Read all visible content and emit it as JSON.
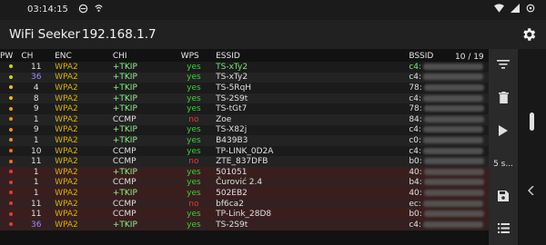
{
  "status_bar": {
    "time": "03:14:15"
  },
  "app": {
    "title": "WiFi Seeker",
    "ip": "192.168.1.7"
  },
  "table": {
    "headers": {
      "pw": "PW",
      "ch": "CH",
      "enc": "ENC",
      "chi": "CHI",
      "wps": "WPS",
      "essid": "ESSID",
      "bssid": "BSSID"
    },
    "counter": "10 / 19",
    "rows": [
      {
        "dot": "#c6d61a",
        "ch": "11",
        "ch_color": "#e0e0e0",
        "enc": "WPA2",
        "enc_color": "#d9b200",
        "chi": "+TKIP",
        "chi_color": "#8ef28e",
        "wps": "yes",
        "wps_color": "#3ccf3c",
        "essid": "TS-xTy2",
        "essid_color": "#7fe37f",
        "bssid": "c4:",
        "bssid_color": "#7fe37f",
        "bg": "dim"
      },
      {
        "dot": "#c6d61a",
        "ch": "36",
        "ch_color": "#9a8cff",
        "enc": "WPA2",
        "enc_color": "#d9b200",
        "chi": "+TKIP",
        "chi_color": "#8ef28e",
        "wps": "yes",
        "wps_color": "#3ccf3c",
        "essid": "TS-xTy2",
        "essid_color": "#e0e0e0",
        "bssid": "c4:",
        "bssid_color": "#e0e0e0",
        "bg": "alt"
      },
      {
        "dot": "#e8c01a",
        "ch": "4",
        "ch_color": "#e0e0e0",
        "enc": "WPA2",
        "enc_color": "#d9b200",
        "chi": "+TKIP",
        "chi_color": "#8ef28e",
        "wps": "yes",
        "wps_color": "#3ccf3c",
        "essid": "TS-5RqH",
        "essid_color": "#e0e0e0",
        "bssid": "78:",
        "bssid_color": "#e0e0e0",
        "bg": "dim"
      },
      {
        "dot": "#e8c01a",
        "ch": "8",
        "ch_color": "#e0e0e0",
        "enc": "WPA2",
        "enc_color": "#d9b200",
        "chi": "+TKIP",
        "chi_color": "#8ef28e",
        "wps": "yes",
        "wps_color": "#3ccf3c",
        "essid": "TS-2S9t",
        "essid_color": "#e0e0e0",
        "bssid": "c4:",
        "bssid_color": "#e0e0e0",
        "bg": "alt"
      },
      {
        "dot": "#e8a01a",
        "ch": "9",
        "ch_color": "#e0e0e0",
        "enc": "WPA2",
        "enc_color": "#d9b200",
        "chi": "+TKIP",
        "chi_color": "#8ef28e",
        "wps": "yes",
        "wps_color": "#3ccf3c",
        "essid": "TS-tGt7",
        "essid_color": "#e0e0e0",
        "bssid": "78:",
        "bssid_color": "#e0e0e0",
        "bg": "dim"
      },
      {
        "dot": "#e8901a",
        "ch": "1",
        "ch_color": "#e0e0e0",
        "enc": "WPA2",
        "enc_color": "#d9b200",
        "chi": "CCMP",
        "chi_color": "#e0e0e0",
        "wps": "no",
        "wps_color": "#e53935",
        "essid": "Zoe",
        "essid_color": "#e0e0e0",
        "bssid": "84:",
        "bssid_color": "#e0e0e0",
        "bg": "alt"
      },
      {
        "dot": "#e8901a",
        "ch": "9",
        "ch_color": "#e0e0e0",
        "enc": "WPA2",
        "enc_color": "#d9b200",
        "chi": "+TKIP",
        "chi_color": "#8ef28e",
        "wps": "yes",
        "wps_color": "#3ccf3c",
        "essid": "TS-X82j",
        "essid_color": "#e0e0e0",
        "bssid": "c4:",
        "bssid_color": "#e0e0e0",
        "bg": "dim"
      },
      {
        "dot": "#e8901a",
        "ch": "1",
        "ch_color": "#e0e0e0",
        "enc": "WPA2",
        "enc_color": "#d9b200",
        "chi": "+TKIP",
        "chi_color": "#8ef28e",
        "wps": "yes",
        "wps_color": "#3ccf3c",
        "essid": "B439B3",
        "essid_color": "#e0e0e0",
        "bssid": "c0:",
        "bssid_color": "#e0e0e0",
        "bg": "alt"
      },
      {
        "dot": "#e8701a",
        "ch": "10",
        "ch_color": "#e0e0e0",
        "enc": "WPA2",
        "enc_color": "#d9b200",
        "chi": "CCMP",
        "chi_color": "#e0e0e0",
        "wps": "yes",
        "wps_color": "#3ccf3c",
        "essid": "TP-LINK_0D2A",
        "essid_color": "#e0e0e0",
        "bssid": "c4:",
        "bssid_color": "#e0e0e0",
        "bg": "dim"
      },
      {
        "dot": "#e8701a",
        "ch": "11",
        "ch_color": "#e0e0e0",
        "enc": "WPA2",
        "enc_color": "#d9b200",
        "chi": "CCMP",
        "chi_color": "#e0e0e0",
        "wps": "no",
        "wps_color": "#e53935",
        "essid": "ZTE_837DFB",
        "essid_color": "#e0e0e0",
        "bssid": "b0:",
        "bssid_color": "#e0e0e0",
        "bg": "alt"
      },
      {
        "dot": "#e53935",
        "ch": "1",
        "ch_color": "#e0e0e0",
        "enc": "WPA2",
        "enc_color": "#d9b200",
        "chi": "+TKIP",
        "chi_color": "#8ef28e",
        "wps": "yes",
        "wps_color": "#3ccf3c",
        "essid": "501051",
        "essid_color": "#e0e0e0",
        "bssid": "40:",
        "bssid_color": "#e0e0e0",
        "bg": "red"
      },
      {
        "dot": "#e53935",
        "ch": "1",
        "ch_color": "#e0e0e0",
        "enc": "WPA2",
        "enc_color": "#d9b200",
        "chi": "CCMP",
        "chi_color": "#e0e0e0",
        "wps": "yes",
        "wps_color": "#3ccf3c",
        "essid": "Čurović 2.4",
        "essid_color": "#e0e0e0",
        "bssid": "b4:",
        "bssid_color": "#e0e0e0",
        "bg": "red2"
      },
      {
        "dot": "#e53935",
        "ch": "1",
        "ch_color": "#e0e0e0",
        "enc": "WPA2",
        "enc_color": "#d9b200",
        "chi": "+TKIP",
        "chi_color": "#8ef28e",
        "wps": "yes",
        "wps_color": "#3ccf3c",
        "essid": "502EB2",
        "essid_color": "#e0e0e0",
        "bssid": "40:",
        "bssid_color": "#e0e0e0",
        "bg": "red"
      },
      {
        "dot": "#e53935",
        "ch": "11",
        "ch_color": "#e0e0e0",
        "enc": "WPA2",
        "enc_color": "#d9b200",
        "chi": "CCMP",
        "chi_color": "#e0e0e0",
        "wps": "no",
        "wps_color": "#e53935",
        "essid": "bf6ca2",
        "essid_color": "#e0e0e0",
        "bssid": "ec:",
        "bssid_color": "#e0e0e0",
        "bg": "red2"
      },
      {
        "dot": "#e53935",
        "ch": "11",
        "ch_color": "#e0e0e0",
        "enc": "WPA2",
        "enc_color": "#d9b200",
        "chi": "CCMP",
        "chi_color": "#e0e0e0",
        "wps": "yes",
        "wps_color": "#3ccf3c",
        "essid": "TP-Link_28D8",
        "essid_color": "#e0e0e0",
        "bssid": "b0:",
        "bssid_color": "#e0e0e0",
        "bg": "red"
      },
      {
        "dot": "#e53935",
        "ch": "36",
        "ch_color": "#9a8cff",
        "enc": "WPA2",
        "enc_color": "#d9b200",
        "chi": "+TKIP",
        "chi_color": "#8ef28e",
        "wps": "yes",
        "wps_color": "#3ccf3c",
        "essid": "TS-2S9t",
        "essid_color": "#e0e0e0",
        "bssid": "c4:",
        "bssid_color": "#e0e0e0",
        "bg": "red2"
      }
    ]
  },
  "sidebar": {
    "interval_label": "5 s..."
  },
  "icons": [
    "settings-gear-icon",
    "filter-icon",
    "delete-icon",
    "play-icon",
    "save-icon",
    "list-icon",
    "chevron-left-icon"
  ]
}
